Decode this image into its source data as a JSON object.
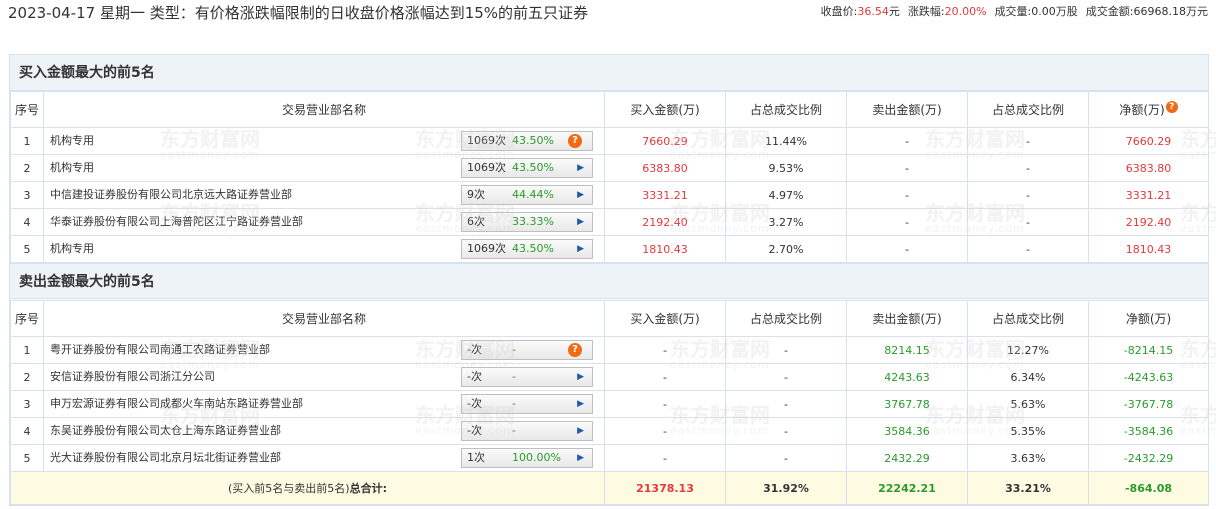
{
  "header": {
    "title": "2023-04-17 星期一 类型：有价格涨跌幅限制的日收盘价格涨幅达到15%的前五只证券",
    "close_label": "收盘价:",
    "close_value": "36.54",
    "close_unit": "元",
    "change_label": "涨跌幅:",
    "change_value": "20.00%",
    "volume_label": "成交量:",
    "volume_value": "0.00万股",
    "amount_label": "成交金额:",
    "amount_value": "66968.18万元"
  },
  "buy_section": {
    "title": "买入金额最大的前5名",
    "columns": {
      "index": "序号",
      "name": "交易营业部名称",
      "buy": "买入金额(万)",
      "buy_pct": "占总成交比例",
      "sell": "卖出金额(万)",
      "sell_pct": "占总成交比例",
      "net": "净额(万)"
    },
    "rows": [
      {
        "idx": "1",
        "name": "机构专用",
        "count": "1069次",
        "rate": "43.50%",
        "buy": "7660.29",
        "buy_pct": "11.44%",
        "sell": "-",
        "sell_pct": "-",
        "net": "7660.29"
      },
      {
        "idx": "2",
        "name": "机构专用",
        "count": "1069次",
        "rate": "43.50%",
        "buy": "6383.80",
        "buy_pct": "9.53%",
        "sell": "-",
        "sell_pct": "-",
        "net": "6383.80"
      },
      {
        "idx": "3",
        "name": "中信建投证券股份有限公司北京远大路证券营业部",
        "count": "9次",
        "rate": "44.44%",
        "buy": "3331.21",
        "buy_pct": "4.97%",
        "sell": "-",
        "sell_pct": "-",
        "net": "3331.21"
      },
      {
        "idx": "4",
        "name": "华泰证券股份有限公司上海普陀区江宁路证券营业部",
        "count": "6次",
        "rate": "33.33%",
        "buy": "2192.40",
        "buy_pct": "3.27%",
        "sell": "-",
        "sell_pct": "-",
        "net": "2192.40"
      },
      {
        "idx": "5",
        "name": "机构专用",
        "count": "1069次",
        "rate": "43.50%",
        "buy": "1810.43",
        "buy_pct": "2.70%",
        "sell": "-",
        "sell_pct": "-",
        "net": "1810.43"
      }
    ]
  },
  "sell_section": {
    "title": "卖出金额最大的前5名",
    "columns": {
      "index": "序号",
      "name": "交易营业部名称",
      "buy": "买入金额(万)",
      "buy_pct": "占总成交比例",
      "sell": "卖出金额(万)",
      "sell_pct": "占总成交比例",
      "net": "净额(万)"
    },
    "rows": [
      {
        "idx": "1",
        "name": "粤开证券股份有限公司南通工农路证券营业部",
        "count": "-次",
        "rate": "-",
        "buy": "-",
        "buy_pct": "-",
        "sell": "8214.15",
        "sell_pct": "12.27%",
        "net": "-8214.15"
      },
      {
        "idx": "2",
        "name": "安信证券股份有限公司浙江分公司",
        "count": "-次",
        "rate": "-",
        "buy": "-",
        "buy_pct": "-",
        "sell": "4243.63",
        "sell_pct": "6.34%",
        "net": "-4243.63"
      },
      {
        "idx": "3",
        "name": "申万宏源证券有限公司成都火车南站东路证券营业部",
        "count": "-次",
        "rate": "-",
        "buy": "-",
        "buy_pct": "-",
        "sell": "3767.78",
        "sell_pct": "5.63%",
        "net": "-3767.78"
      },
      {
        "idx": "4",
        "name": "东吴证券股份有限公司太仓上海东路证券营业部",
        "count": "-次",
        "rate": "-",
        "buy": "-",
        "buy_pct": "-",
        "sell": "3584.36",
        "sell_pct": "5.35%",
        "net": "-3584.36"
      },
      {
        "idx": "5",
        "name": "光大证券股份有限公司北京月坛北街证券营业部",
        "count": "1次",
        "rate": "100.00%",
        "buy": "-",
        "buy_pct": "-",
        "sell": "2432.29",
        "sell_pct": "3.63%",
        "net": "-2432.29"
      }
    ],
    "total": {
      "label_normal": "(买入前5名与卖出前5名)",
      "label_bold": "总合计:",
      "buy": "21378.13",
      "buy_pct": "31.92%",
      "sell": "22242.21",
      "sell_pct": "33.21%",
      "net": "-864.08"
    }
  },
  "watermark": {
    "cn": "东方财富网",
    "en": "eastmoney.com"
  },
  "colors": {
    "positive": "#e4393c",
    "negative": "#2a9b2a",
    "header_bg": "#eef3f8",
    "total_bg": "#fffbe3",
    "help_icon": "#f06a12",
    "arrow_icon": "#1e5aa8"
  }
}
